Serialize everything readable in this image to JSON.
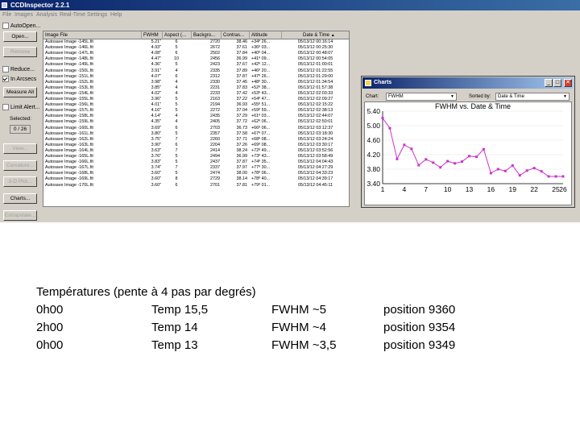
{
  "window": {
    "title": "CCDInspector 2.2.1"
  },
  "menu": [
    "File",
    "Images",
    "Analysis",
    "Real-Time",
    "Settings",
    "Help"
  ],
  "left_panel": {
    "autoopen": "AutoOpen...",
    "open": "Open...",
    "remove": "Remove",
    "reduce": "Reduce...",
    "in_arcsecs": "In Arcsecs",
    "measure_all": "Measure All",
    "limit_alert": "Limit Alert...",
    "selected_label": "Selected:",
    "selected_count": "0 / 26",
    "view": "View...",
    "curvature": "Curvature...",
    "plot3d": "3-D Plot...",
    "charts": "Charts...",
    "extrapolate": "Extrapolate..."
  },
  "table": {
    "headers": [
      "Image File",
      "FWHM",
      "Aspect (...",
      "Backgro...",
      "Contras...",
      "Altitude",
      "Date & Time"
    ],
    "sort_indicator": "▲",
    "rows": [
      [
        "Autosave Image -145L.fit",
        "5.21\"",
        "6",
        "2720",
        "38.46",
        "+34º 26...",
        "05/13/12 00:16:14"
      ],
      [
        "Autosave Image -146L.fit",
        "4.93\"",
        "5",
        "2672",
        "37.61",
        "+36º 03...",
        "05/13/12 00:25:30"
      ],
      [
        "Autosave Image -147L.fit",
        "4.08\"",
        "6",
        "2502",
        "37.84",
        "+40º 04...",
        "05/13/12 00:48:07"
      ],
      [
        "Autosave Image -148L.fit",
        "4.47\"",
        "10",
        "2456",
        "36.99",
        "+41º 09...",
        "05/13/12 00:54:05"
      ],
      [
        "Autosave Image -149L.fit",
        "4.36\"",
        "5",
        "2423",
        "37.67",
        "+42º 12...",
        "05/13/12 01:00:01"
      ],
      [
        "Autosave Image -150L.fit",
        "3.91\"",
        "4",
        "2335",
        "37.89",
        "+46º 20...",
        "05/13/12 01:22:55"
      ],
      [
        "Autosave Image -151L.fit",
        "4.07\"",
        "6",
        "2312",
        "37.87",
        "+47º 26...",
        "05/13/12 01:29:00"
      ],
      [
        "Autosave Image -152L.fit",
        "3.98\"",
        "4",
        "2330",
        "37.45",
        "+48º 30...",
        "05/13/12 01:34:54"
      ],
      [
        "Autosave Image -153L.fit",
        "3.85\"",
        "4",
        "2231",
        "37.83",
        "+52º 38...",
        "05/13/12 01:57:38"
      ],
      [
        "Autosave Image -154L.fit",
        "4.02\"",
        "4",
        "2233",
        "37.42",
        "+53º 43...",
        "05/13/12 02:03:33"
      ],
      [
        "Autosave Image -155L.fit",
        "3.96\"",
        "5",
        "2163",
        "37.22",
        "+54º 47...",
        "05/13/12 02:09:27"
      ],
      [
        "Autosave Image -156L.fit",
        "4.01\"",
        "5",
        "2194",
        "36.93",
        "+55º 51...",
        "05/13/12 02:15:22"
      ],
      [
        "Autosave Image -157L.fit",
        "4.16\"",
        "5",
        "2272",
        "37.04",
        "+59º 59...",
        "05/13/12 02:38:13"
      ],
      [
        "Autosave Image -158L.fit",
        "4.14\"",
        "4",
        "2435",
        "37.29",
        "+61º 03...",
        "05/13/12 02:44:07"
      ],
      [
        "Autosave Image -159L.fit",
        "4.35\"",
        "4",
        "2405",
        "37.72",
        "+62º 06...",
        "05/13/12 02:50:01"
      ],
      [
        "Autosave Image -160L.fit",
        "3.69\"",
        "6",
        "2703",
        "36.73",
        "+66º 06...",
        "05/13/12 03:12:37"
      ],
      [
        "Autosave Image -161L.fit",
        "3.80\"",
        "5",
        "2357",
        "37.58",
        "+67º 07...",
        "05/13/12 03:18:30"
      ],
      [
        "Autosave Image -162L.fit",
        "3.75\"",
        "7",
        "2260",
        "37.71",
        "+68º 08...",
        "05/13/12 03:24:24"
      ],
      [
        "Autosave Image -163L.fit",
        "3.90\"",
        "6",
        "2204",
        "37.26",
        "+69º 08...",
        "05/13/12 03:30:17"
      ],
      [
        "Autosave Image -164L.fit",
        "3.63\"",
        "7",
        "2414",
        "38.24",
        "+72º 49...",
        "05/13/12 03:52:56"
      ],
      [
        "Autosave Image -165L.fit",
        "3.76\"",
        "5",
        "2494",
        "36.99",
        "+73º 43...",
        "05/13/12 03:58:49"
      ],
      [
        "Autosave Image -166L.fit",
        "3.83\"",
        "5",
        "2437",
        "37.87",
        "+74º 35...",
        "05/13/12 04:04:43"
      ],
      [
        "Autosave Image -167L.fit",
        "3.74\"",
        "7",
        "2337",
        "37.97",
        "+77º 30...",
        "05/13/12 04:27:29"
      ],
      [
        "Autosave Image -168L.fit",
        "3.60\"",
        "5",
        "2474",
        "38.00",
        "+78º 06...",
        "05/13/12 04:33:23"
      ],
      [
        "Autosave Image -169L.fit",
        "3.60\"",
        "8",
        "2729",
        "38.14",
        "+78º 40...",
        "05/13/12 04:39:17"
      ],
      [
        "Autosave Image -170L.fit",
        "3.60\"",
        "6",
        "2701",
        "37.81",
        "+79º 01...",
        "05/13/12 04:45:11"
      ]
    ]
  },
  "chart_window": {
    "title": "Charts",
    "chart_label": "Chart:",
    "chart_value": "FWHM",
    "sorted_label": "Sorted by:",
    "sorted_value": "Date & Time"
  },
  "chart_data": {
    "type": "line",
    "title": "FWHM vs. Date & Time",
    "color": "#cc33cc",
    "x": [
      1,
      2,
      3,
      4,
      5,
      6,
      7,
      8,
      9,
      10,
      11,
      12,
      13,
      14,
      15,
      16,
      17,
      18,
      19,
      20,
      21,
      22,
      23,
      24,
      25,
      26
    ],
    "values": [
      5.21,
      4.93,
      4.08,
      4.47,
      4.36,
      3.91,
      4.07,
      3.98,
      3.85,
      4.02,
      3.96,
      4.01,
      4.16,
      4.14,
      4.35,
      3.69,
      3.8,
      3.75,
      3.9,
      3.63,
      3.76,
      3.83,
      3.74,
      3.6,
      3.6,
      3.6
    ],
    "xlim": [
      1,
      26
    ],
    "ylim": [
      3.4,
      5.4
    ],
    "xticks": [
      "1",
      "4",
      "7",
      "10",
      "13",
      "16",
      "19",
      "22",
      "25",
      "26"
    ],
    "xtick_values": [
      1,
      4,
      7,
      10,
      13,
      16,
      19,
      22,
      25,
      26
    ],
    "yticks": [
      "3.40",
      "3.80",
      "4.20",
      "4.60",
      "5.00",
      "5.40"
    ],
    "ytick_values": [
      3.4,
      3.8,
      4.2,
      4.6,
      5.0,
      5.4
    ]
  },
  "notes": {
    "heading": "Températures (pente à 4 pas par degrés)",
    "rows": [
      [
        "0h00",
        "Temp 15,5",
        "FWHM ~5",
        "position 9360"
      ],
      [
        "2h00",
        "Temp 14",
        "FWHM ~4",
        "position 9354"
      ],
      [
        "0h00",
        "Temp 13",
        "FWHM ~3,5",
        "position 9349"
      ]
    ]
  }
}
